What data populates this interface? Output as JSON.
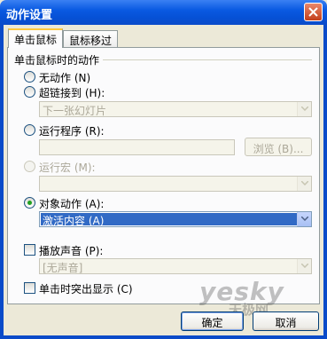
{
  "window": {
    "title": "动作设置",
    "close_icon": "close-x-icon"
  },
  "tabs": [
    {
      "label": "单击鼠标",
      "active": true
    },
    {
      "label": "鼠标移过",
      "active": false
    }
  ],
  "action_group": {
    "label": "单击鼠标时的动作",
    "options": {
      "none": "无动作 (N)",
      "hyperlink": "超链接到 (H):",
      "run_program": "运行程序 (R):",
      "run_macro": "运行宏 (M):",
      "object_action": "对象动作 (A):"
    },
    "hyperlink_value": "下一张幻灯片",
    "browse_label": "浏览 (B)...",
    "object_action_value": "激活内容 (A)"
  },
  "sound": {
    "label": "播放声音 (P):",
    "value": "[无声音]"
  },
  "highlight": {
    "label": "单击时突出显示 (C)"
  },
  "buttons": {
    "ok": "确定",
    "cancel": "取消"
  },
  "watermark": {
    "brand": "yesky",
    "sub": "天极网"
  },
  "colors": {
    "titlebar": "#0a5ae2",
    "selection": "#316ac5",
    "radio_dot": "#21a121"
  }
}
